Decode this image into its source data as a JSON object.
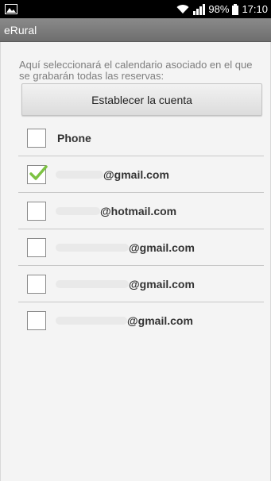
{
  "status_bar": {
    "battery": "98%",
    "time": "17:10",
    "icons": [
      "image-notification-icon",
      "wifi-icon",
      "signal-icon",
      "battery-icon"
    ]
  },
  "app": {
    "title": "eRural"
  },
  "instructions": "Aquí seleccionará el calendario asociado en el que se grabarán todas las reservas:",
  "set_account_button": "Establecer la cuenta",
  "accounts": [
    {
      "label": "Phone",
      "checked": false
    },
    {
      "label": "@gmail.com",
      "checked": true
    },
    {
      "label": "@hotmail.com",
      "checked": false
    },
    {
      "label": "@gmail.com",
      "checked": false
    },
    {
      "label": "@gmail.com",
      "checked": false
    },
    {
      "label": "@gmail.com",
      "checked": false
    }
  ],
  "colors": {
    "check": "#7cc242",
    "action_bar": "#7a7a7a",
    "status_bar": "#000000"
  }
}
